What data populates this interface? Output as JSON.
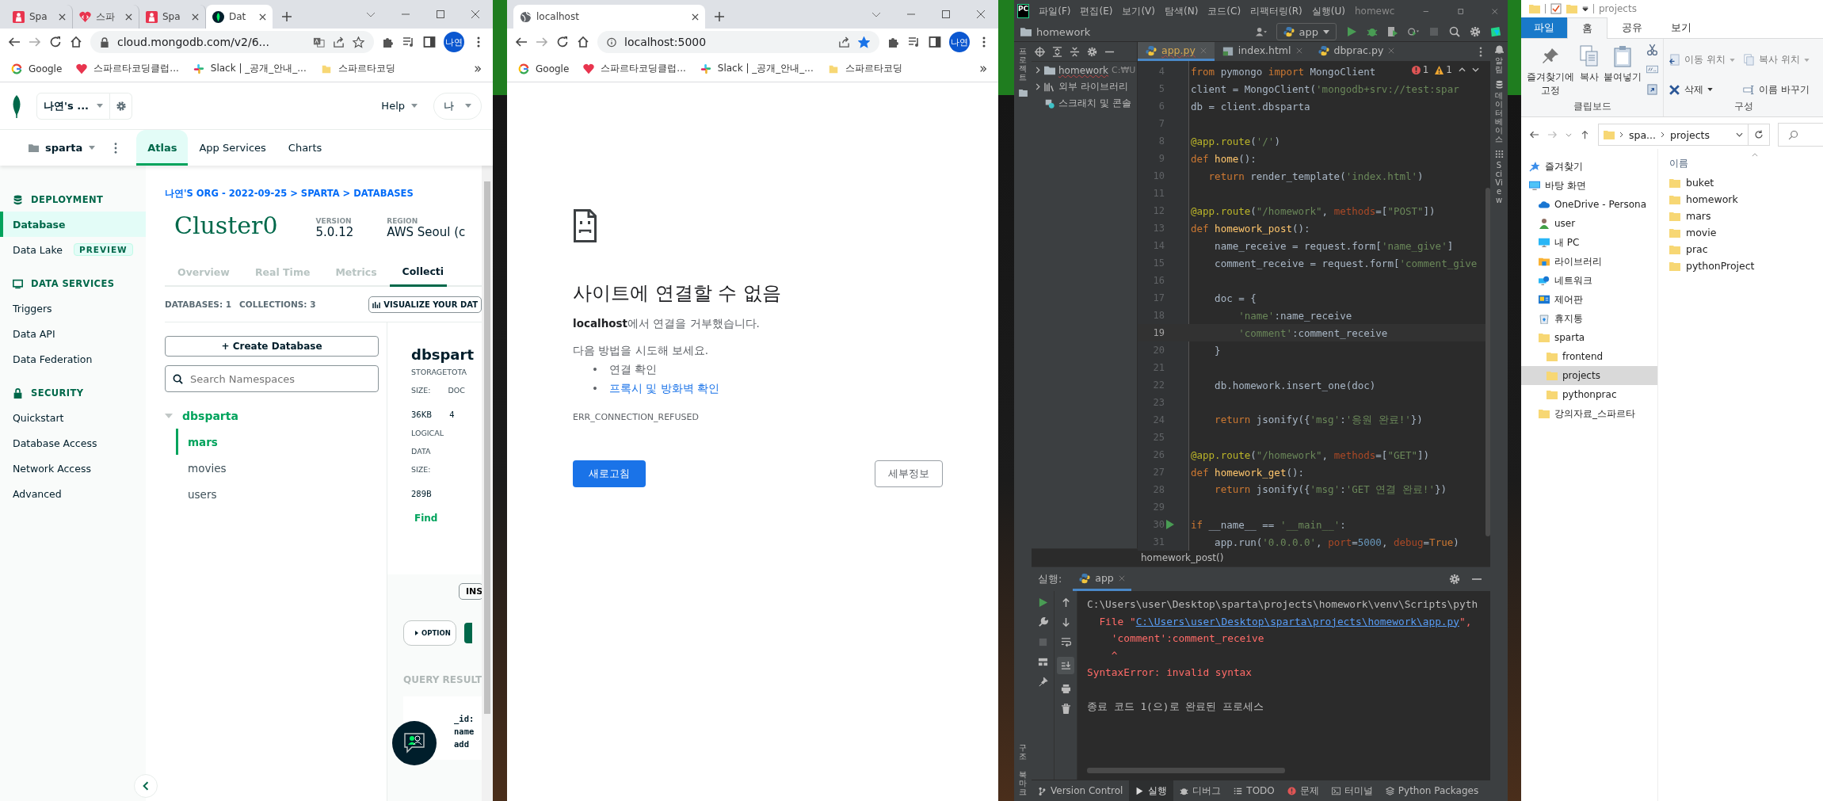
{
  "mongo_browser": {
    "tabs": [
      {
        "title": "Spa",
        "selected": false
      },
      {
        "title": "스파",
        "selected": false
      },
      {
        "title": "Spa",
        "selected": false
      },
      {
        "title": "Dat",
        "selected": true
      }
    ],
    "address": "cloud.mongodb.com/v2/6...",
    "translate_offered": true,
    "bookmarked": false,
    "bookmarks": [
      "Google",
      "스파르타코딩클럽...",
      "Slack | _공개_안내_...",
      "스파르타코딩"
    ],
    "profile": "나연",
    "org": "나연's ...",
    "help": "Help",
    "user_menu": "나",
    "project": "sparta",
    "nav_tabs": [
      {
        "label": "Atlas",
        "selected": true
      },
      {
        "label": "App Services",
        "selected": false
      },
      {
        "label": "Charts",
        "selected": false
      }
    ],
    "sidebar": [
      {
        "heading": "DEPLOYMENT",
        "items": [
          {
            "label": "Database",
            "selected": true
          },
          {
            "label": "Data Lake",
            "selected": false,
            "badge": "PREVIEW"
          }
        ]
      },
      {
        "heading": "DATA SERVICES",
        "items": [
          {
            "label": "Triggers",
            "selected": false
          },
          {
            "label": "Data API",
            "selected": false
          },
          {
            "label": "Data Federation",
            "selected": false
          }
        ]
      },
      {
        "heading": "SECURITY",
        "items": [
          {
            "label": "Quickstart",
            "selected": false
          },
          {
            "label": "Database Access",
            "selected": false
          },
          {
            "label": "Network Access",
            "selected": false
          },
          {
            "label": "Advanced",
            "selected": false
          }
        ]
      }
    ],
    "breadcrumb": "나연'S ORG - 2022-09-25 > SPARTA > DATABASES",
    "cluster": {
      "name": "Cluster0",
      "version_label": "VERSION",
      "version": "5.0.12",
      "region_label": "REGION",
      "region": "AWS Seoul (c"
    },
    "cluster_tabs": [
      {
        "label": "Overview",
        "selected": false
      },
      {
        "label": "Real Time",
        "selected": false
      },
      {
        "label": "Metrics",
        "selected": false
      },
      {
        "label": "Collecti",
        "selected": true
      }
    ],
    "databases_count": "DATABASES: 1",
    "collections_count": "COLLECTIONS: 3",
    "visualize_button": "VISUALIZE YOUR DAT",
    "create_button": "+ Create Database",
    "search": {
      "placeholder": "Search Namespaces"
    },
    "tree": [
      {
        "label": "dbsparta",
        "expanded": true,
        "children": [
          {
            "label": "mars",
            "selected": true
          },
          {
            "label": "movies",
            "selected": false
          },
          {
            "label": "users",
            "selected": false
          }
        ]
      }
    ],
    "detail": {
      "title": "dbspart",
      "storage_label": "STORAGETOTA",
      "size_label": "SIZE:",
      "docs_label": "DOC",
      "storage": "36KB",
      "docs": "4",
      "logical_label": [
        "LOGICAL",
        "DATA",
        "SIZE:"
      ],
      "logical": "289B",
      "find": "Find",
      "insert_button": "INS",
      "options_button": "OPTION",
      "results_label": "QUERY RESULT",
      "result_lines": [
        "_id:",
        "name",
        "add"
      ]
    }
  },
  "localhost_browser": {
    "tabs": [
      {
        "title": "localhost",
        "selected": true
      }
    ],
    "address": "localhost:5000",
    "translate_offered": false,
    "bookmarked": true,
    "bookmarks": [
      "Google",
      "스파르타코딩클럽...",
      "Slack | _공개_안내_...",
      "스파르타코딩"
    ],
    "profile": "나연",
    "error": {
      "title": "사이트에 연결할 수 없음",
      "message": "**localhost**에서 연결을 거부했습니다.",
      "suggest": "다음 방법을 시도해 보세요.",
      "suggestions": [
        {
          "bullet": "•",
          "label": "연결 확인",
          "link": false
        },
        {
          "bullet": "•",
          "label": "프록시 및 방화벽 확인",
          "link": true
        }
      ],
      "code": "ERR_CONNECTION_REFUSED",
      "reload": "새로고침",
      "details": "세부정보"
    }
  },
  "pycharm": {
    "logo": "PC",
    "menu": [
      "파일(F)",
      "편집(E)",
      "보기(V)",
      "탐색(N)",
      "코드(C)",
      "리팩터링(R)",
      "실행(U)"
    ],
    "title": "homewc",
    "project": "homework",
    "run_config": "app",
    "left_side_tabs": [
      "프로젝트"
    ],
    "left_bottom_tabs": [
      "구조",
      "북마크"
    ],
    "right_side_tabs": [
      "알림",
      "데이터베이스",
      "SciView"
    ],
    "tree": [
      {
        "label": "homework",
        "path": "C:₩U",
        "expanded": false
      },
      {
        "label": "외부 라이브러리",
        "expanded": false
      },
      {
        "label": "스크래치 및 콘솔"
      }
    ],
    "editor_tabs": [
      {
        "label": "app.py",
        "selected": true
      },
      {
        "label": "index.html",
        "selected": false
      },
      {
        "label": "dbprac.py",
        "selected": false
      }
    ],
    "errors": "1",
    "warnings": "1",
    "code_lines": [
      {
        "number": "4",
        "text": "from pymongo import MongoClient"
      },
      {
        "number": "5",
        "text": "client = MongoClient('mongodb+srv://test:spar"
      },
      {
        "number": "6",
        "text": "db = client.dbsparta"
      },
      {
        "number": "7"
      },
      {
        "number": "8",
        "text": "@app.route('/')"
      },
      {
        "number": "9",
        "text": "def home():"
      },
      {
        "number": "10",
        "text": "   return render_template('index.html')"
      },
      {
        "number": "11"
      },
      {
        "number": "12",
        "text": "@app.route(\"/homework\", methods=[\"POST\"])"
      },
      {
        "number": "13",
        "text": "def homework_post():"
      },
      {
        "number": "14",
        "text": "    name_receive = request.form['name_give']"
      },
      {
        "number": "15",
        "text": "    comment_receive = request.form['comment_give"
      },
      {
        "number": "16"
      },
      {
        "number": "17",
        "text": "    doc = {"
      },
      {
        "number": "18",
        "text": "        'name':name_receive"
      },
      {
        "number": "19",
        "text": "        'comment':comment_receive",
        "current": true
      },
      {
        "number": "20",
        "text": "    }"
      },
      {
        "number": "21"
      },
      {
        "number": "22",
        "text": "    db.homework.insert_one(doc)"
      },
      {
        "number": "23"
      },
      {
        "number": "24",
        "text": "    return jsonify({'msg':'응원 완료!'})"
      },
      {
        "number": "25"
      },
      {
        "number": "26",
        "text": "@app.route(\"/homework\", methods=[\"GET\"])"
      },
      {
        "number": "27",
        "text": "def homework_get():"
      },
      {
        "number": "28",
        "text": "    return jsonify({'msg':'GET 연결 완료!'})"
      },
      {
        "number": "29"
      },
      {
        "number": "30",
        "text": "if __name__ == '__main__':",
        "run": true
      },
      {
        "number": "31",
        "text": "    app.run('0.0.0.0', port=5000, debug=True)"
      }
    ],
    "breadcrumb": "homework_post()",
    "run_label": "실행:",
    "run_tab": "app",
    "output": [
      {
        "kind": "plain",
        "text": "C:\\Users\\user\\Desktop\\sparta\\projects\\homework\\venv\\Scripts\\pyth"
      },
      {
        "kind": "file",
        "prefix": "  File \"",
        "link": "C:\\Users\\user\\Desktop\\sparta\\projects\\homework\\app.py",
        "suffix": "\","
      },
      {
        "kind": "error",
        "text": "    'comment':comment_receive"
      },
      {
        "kind": "error",
        "text": "    ^"
      },
      {
        "kind": "error",
        "text": "SyntaxError: invalid syntax"
      },
      {
        "kind": "blank"
      },
      {
        "kind": "plain",
        "text": "종료 코드 1(으)로 완료된 프로세스"
      }
    ],
    "bottom_tabs": [
      {
        "label": "Version Control",
        "selected": false
      },
      {
        "label": "실행",
        "selected": true
      },
      {
        "label": "디버그",
        "selected": false
      },
      {
        "label": "TODO",
        "selected": false
      },
      {
        "label": "문제",
        "selected": false
      },
      {
        "label": "터미널",
        "selected": false
      },
      {
        "label": "Python Packages",
        "selected": false
      }
    ]
  },
  "explorer": {
    "title": "projects",
    "ribbon_tabs": [
      {
        "label": "파일",
        "selected": false
      },
      {
        "label": "홈",
        "selected": true
      },
      {
        "label": "공유",
        "selected": false
      },
      {
        "label": "보기",
        "selected": false
      }
    ],
    "clipboard_buttons": [
      "즐겨찾기에 고정",
      "복사",
      "붙여넣기"
    ],
    "clipboard_group": "클립보드",
    "organize_buttons": [
      "이동 위치",
      "복사 위치",
      "삭제",
      "이름 바꾸기"
    ],
    "organize_group": "구성",
    "path": [
      "spa...",
      "projects"
    ],
    "nav": [
      {
        "label": "즐겨찾기",
        "selected": false
      },
      {
        "label": "바탕 화면",
        "selected": false,
        "children": [
          {
            "label": "OneDrive - Persona",
            "selected": false
          },
          {
            "label": "user",
            "selected": false
          },
          {
            "label": "내 PC",
            "selected": false
          },
          {
            "label": "라이브러리",
            "selected": false
          },
          {
            "label": "네트워크",
            "selected": false
          },
          {
            "label": "제어판",
            "selected": false
          },
          {
            "label": "휴지통",
            "selected": false
          },
          {
            "label": "sparta",
            "selected": false,
            "children": [
              {
                "label": "frontend",
                "selected": false
              },
              {
                "label": "projects",
                "selected": true
              },
              {
                "label": "pythonprac",
                "selected": false
              }
            ]
          },
          {
            "label": "강의자료_스파르타",
            "selected": false
          }
        ]
      }
    ],
    "column": "이름",
    "files": [
      "buket",
      "homework",
      "mars",
      "movie",
      "prac",
      "pythonProject"
    ]
  }
}
